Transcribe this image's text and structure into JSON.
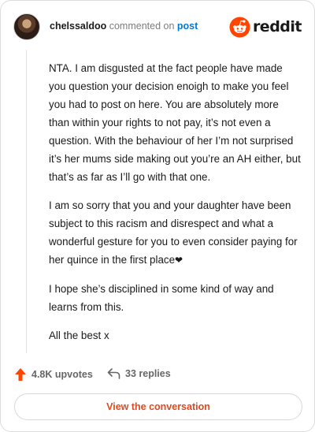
{
  "header": {
    "username": "chelssaldoo",
    "action_text": "commented on",
    "post_link": "post",
    "brand": "reddit"
  },
  "comment": {
    "paragraphs": [
      "NTA. I am disgusted at the fact people have made you question your decision enoigh to make you feel you had to post on here. You are absolutely more than within your rights to not pay, it’s not even a question. With the behaviour of her I’m not surprised it’s her mums side making out you’re an AH either, but that’s as far as I’ll go with that one.",
      "I am so sorry that you and your daughter have been subject to this racism and disrespect and what a wonderful gesture for you to even consider paying for her quince in the first place",
      "I hope she’s disciplined in some kind of way and learns from this.",
      "All the best x"
    ],
    "heart": "❤"
  },
  "actions": {
    "upvotes": "4.8K upvotes",
    "replies": "33 replies"
  },
  "cta": {
    "label": "View the conversation"
  },
  "colors": {
    "brand": "#ff4500",
    "link": "#0079d3",
    "cta_text": "#e0491f"
  },
  "icons": {
    "upvote": "arrow-up-icon",
    "reply": "reply-arrow-icon",
    "brand": "reddit-snoo-icon"
  }
}
